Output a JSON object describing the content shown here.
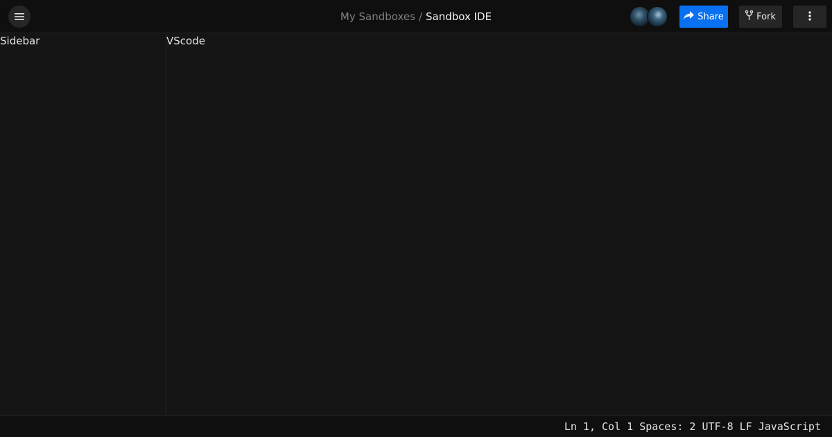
{
  "header": {
    "menu_icon": "hamburger-icon",
    "breadcrumb": {
      "parent": "My Sandboxes",
      "separator": "/",
      "current": "Sandbox IDE"
    },
    "share_label": "Share",
    "share_icon": "share-arrow-icon",
    "fork_label": "Fork",
    "fork_icon": "fork-icon",
    "more_icon": "kebab-menu-icon"
  },
  "sidebar": {
    "label": "Sidebar"
  },
  "editor": {
    "label": "VScode"
  },
  "statusbar": {
    "position": "Ln 1, Col 1",
    "spaces": "Spaces: 2",
    "encoding": "UTF-8",
    "line_ending": "LF",
    "language": "JavaScript"
  },
  "colors": {
    "accent": "#0971f1",
    "background": "#151515",
    "header_bg": "#0f0f0f",
    "button_bg": "#262626"
  }
}
